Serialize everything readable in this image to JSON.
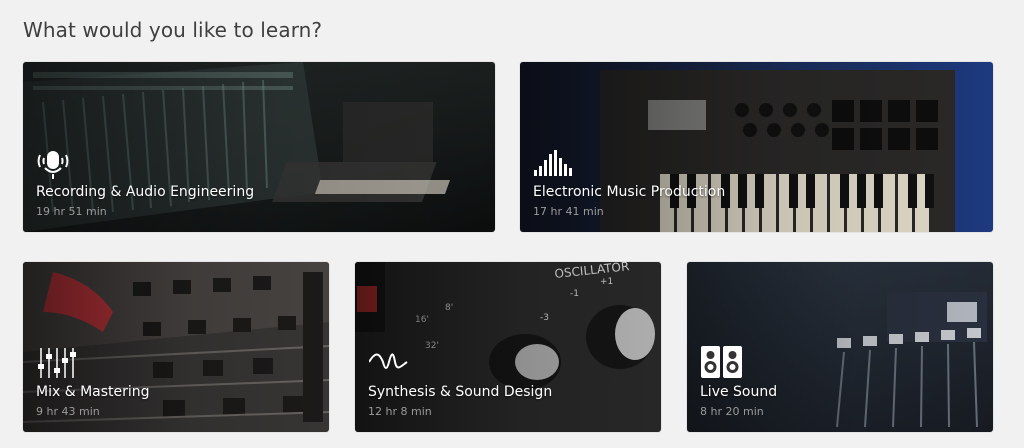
{
  "heading": "What would you like to learn?",
  "cards": [
    {
      "title": "Recording & Audio Engineering",
      "duration": "19 hr 51 min",
      "icon": "microphone-icon"
    },
    {
      "title": "Electronic Music Production",
      "duration": "17 hr 41 min",
      "icon": "equalizer-bars-icon"
    },
    {
      "title": "Mix & Mastering",
      "duration": "9 hr 43 min",
      "icon": "mixer-faders-icon"
    },
    {
      "title": "Synthesis & Sound Design",
      "duration": "12 hr 8 min",
      "icon": "waveform-icon"
    },
    {
      "title": "Live Sound",
      "duration": "8 hr 20 min",
      "icon": "speakers-icon"
    }
  ]
}
